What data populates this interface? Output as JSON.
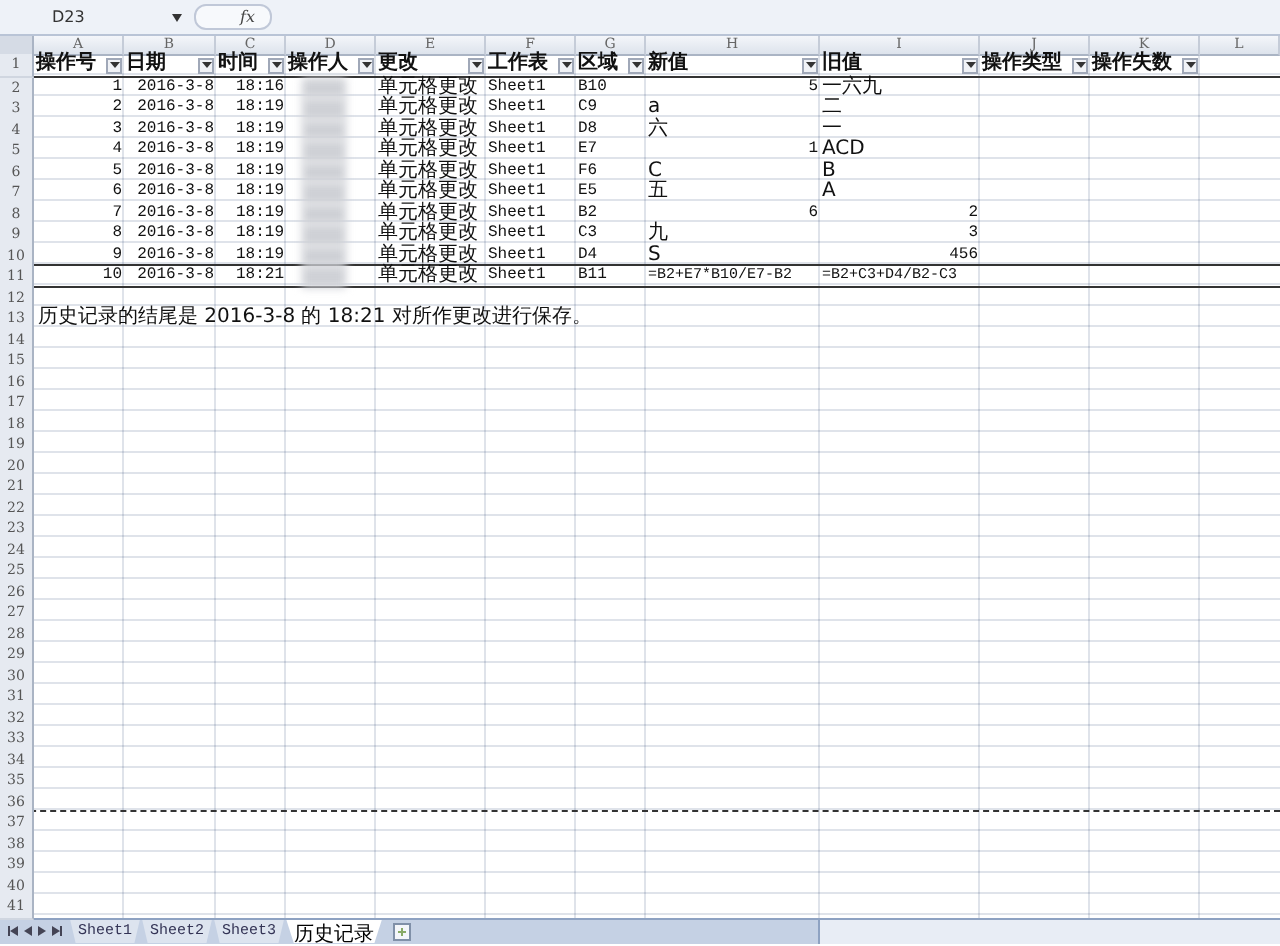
{
  "formula_bar": {
    "name_box": "D23",
    "fx": "fx"
  },
  "columns": [
    "A",
    "B",
    "C",
    "D",
    "E",
    "F",
    "G",
    "H",
    "I",
    "J",
    "K",
    "L"
  ],
  "headers": [
    "操作号",
    "日期",
    "时间",
    "操作人",
    "更改",
    "工作表",
    "区域",
    "新值",
    "旧值",
    "操作类型",
    "操作失数"
  ],
  "row_numbers": [
    "1",
    "2",
    "3",
    "4",
    "5",
    "6",
    "7",
    "8",
    "9",
    "10",
    "11",
    "12",
    "13",
    "14",
    "15",
    "16",
    "17",
    "18",
    "19",
    "20",
    "21",
    "22",
    "23",
    "24",
    "25",
    "26",
    "27",
    "28",
    "29",
    "30",
    "31",
    "32",
    "33",
    "34",
    "35",
    "36",
    "37",
    "38",
    "39",
    "40",
    "41"
  ],
  "rows": [
    {
      "no": "1",
      "date": "2016-3-8",
      "time": "18:16",
      "change": "单元格更改",
      "sheet": "Sheet1",
      "range": "B10",
      "new_value": {
        "text": "5",
        "kind": "number"
      },
      "old_value": {
        "text": "一六九",
        "kind": "text"
      }
    },
    {
      "no": "2",
      "date": "2016-3-8",
      "time": "18:19",
      "change": "单元格更改",
      "sheet": "Sheet1",
      "range": "C9",
      "new_value": {
        "text": "a",
        "kind": "text"
      },
      "old_value": {
        "text": "二",
        "kind": "text"
      }
    },
    {
      "no": "3",
      "date": "2016-3-8",
      "time": "18:19",
      "change": "单元格更改",
      "sheet": "Sheet1",
      "range": "D8",
      "new_value": {
        "text": "六",
        "kind": "text"
      },
      "old_value": {
        "text": "一",
        "kind": "text"
      }
    },
    {
      "no": "4",
      "date": "2016-3-8",
      "time": "18:19",
      "change": "单元格更改",
      "sheet": "Sheet1",
      "range": "E7",
      "new_value": {
        "text": "1",
        "kind": "number"
      },
      "old_value": {
        "text": "ACD",
        "kind": "text"
      }
    },
    {
      "no": "5",
      "date": "2016-3-8",
      "time": "18:19",
      "change": "单元格更改",
      "sheet": "Sheet1",
      "range": "F6",
      "new_value": {
        "text": "C",
        "kind": "text"
      },
      "old_value": {
        "text": "B",
        "kind": "text"
      }
    },
    {
      "no": "6",
      "date": "2016-3-8",
      "time": "18:19",
      "change": "单元格更改",
      "sheet": "Sheet1",
      "range": "E5",
      "new_value": {
        "text": "五",
        "kind": "text"
      },
      "old_value": {
        "text": "A",
        "kind": "text"
      }
    },
    {
      "no": "7",
      "date": "2016-3-8",
      "time": "18:19",
      "change": "单元格更改",
      "sheet": "Sheet1",
      "range": "B2",
      "new_value": {
        "text": "6",
        "kind": "number"
      },
      "old_value": {
        "text": "2",
        "kind": "number"
      }
    },
    {
      "no": "8",
      "date": "2016-3-8",
      "time": "18:19",
      "change": "单元格更改",
      "sheet": "Sheet1",
      "range": "C3",
      "new_value": {
        "text": "九",
        "kind": "text"
      },
      "old_value": {
        "text": "3",
        "kind": "number"
      }
    },
    {
      "no": "9",
      "date": "2016-3-8",
      "time": "18:19",
      "change": "单元格更改",
      "sheet": "Sheet1",
      "range": "D4",
      "new_value": {
        "text": "S",
        "kind": "text"
      },
      "old_value": {
        "text": "456",
        "kind": "number"
      }
    },
    {
      "no": "10",
      "date": "2016-3-8",
      "time": "18:21",
      "change": "单元格更改",
      "sheet": "Sheet1",
      "range": "B11",
      "new_value": {
        "text": "=B2+E7*B10/E7-B2",
        "kind": "formula"
      },
      "old_value": {
        "text": "=B2+C3+D4/B2-C3",
        "kind": "formula"
      }
    }
  ],
  "note": "历史记录的结尾是 2016-3-8 的 18:21 对所作更改进行保存。",
  "sheet_tabs": [
    {
      "label": "Sheet1",
      "selected": false
    },
    {
      "label": "Sheet2",
      "selected": false
    },
    {
      "label": "Sheet3",
      "selected": false
    },
    {
      "label": "历史记录",
      "selected": true
    }
  ]
}
